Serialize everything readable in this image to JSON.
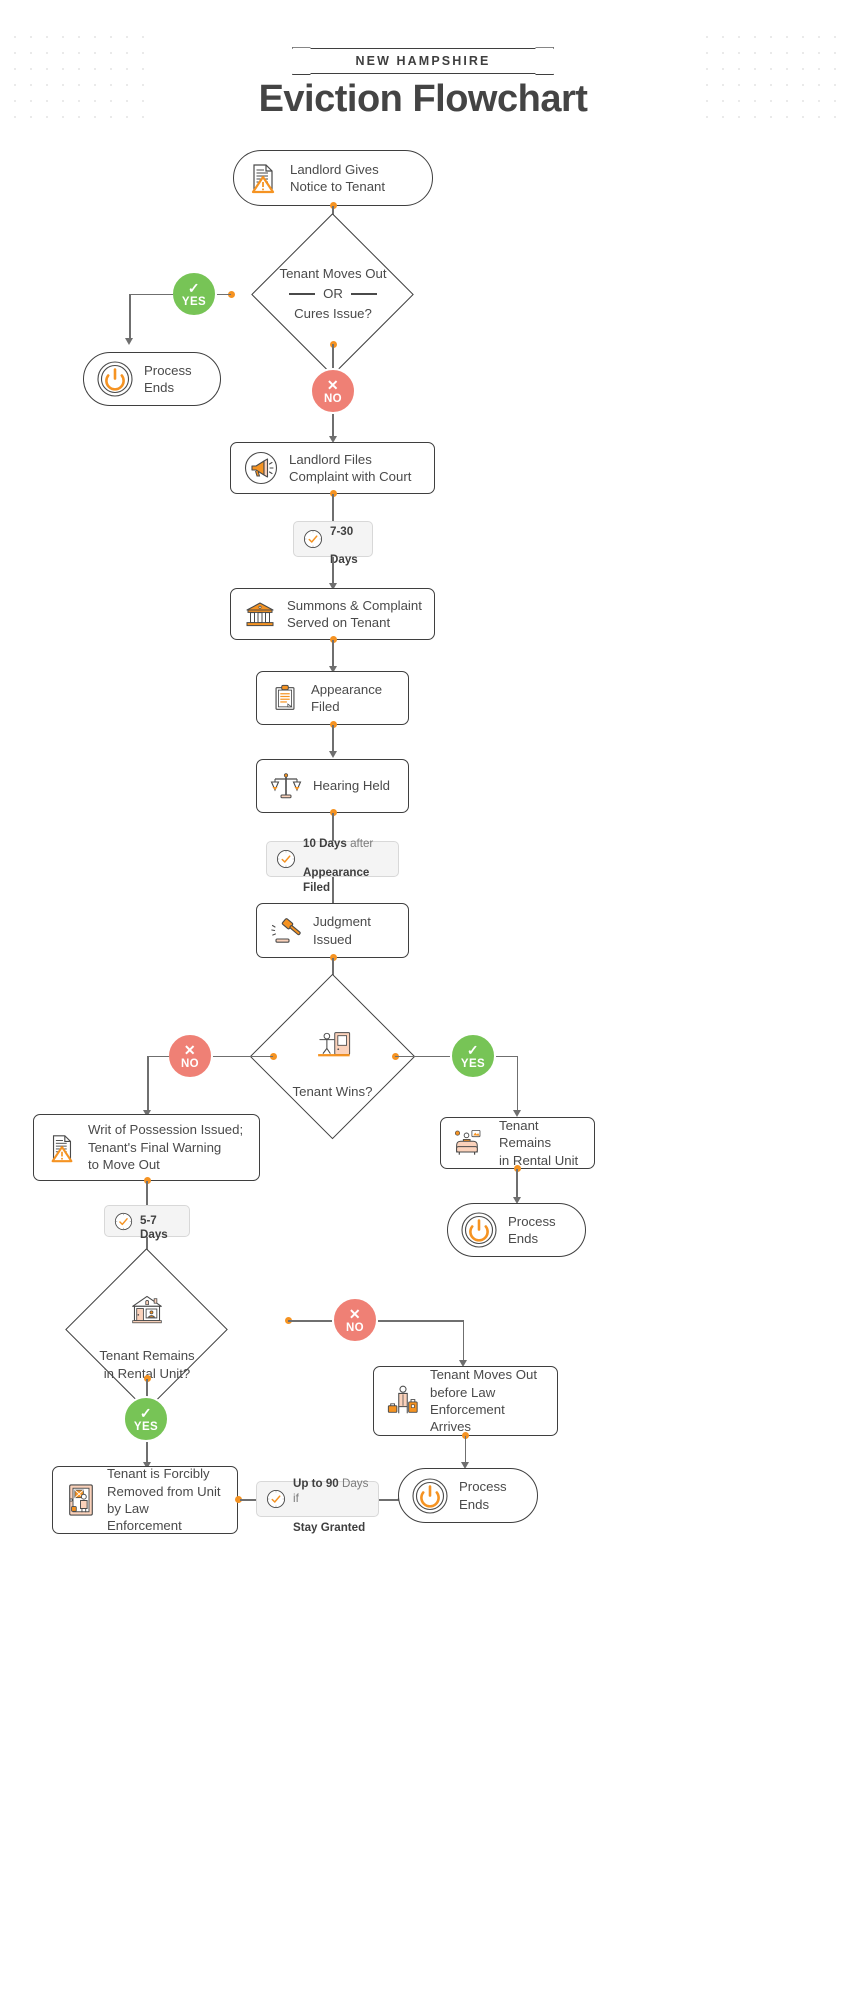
{
  "header": {
    "ribbon_label": "NEW HAMPSHIRE",
    "title": "Eviction Flowchart"
  },
  "colors": {
    "yes_green": "#77c456",
    "no_red": "#ef8075",
    "accent_orange": "#f59322",
    "text_dark": "#4a4a4a",
    "line_gray": "#6f6f6f",
    "timebox_bg": "#f4f4f4"
  },
  "badges": {
    "yes_label": "YES",
    "no_label": "NO"
  },
  "nodes": {
    "notice": {
      "label": "Landlord Gives\nNotice to Tenant",
      "icon": "notice-document-icon"
    },
    "process_ends_1": {
      "label": "Process\nEnds",
      "icon": "power-icon"
    },
    "complaint": {
      "label": "Landlord Files\nComplaint with Court",
      "icon": "megaphone-icon"
    },
    "summons": {
      "label": "Summons & Complaint\nServed on Tenant",
      "icon": "courthouse-icon"
    },
    "appearance": {
      "label": "Appearance\nFiled",
      "icon": "clipboard-icon"
    },
    "hearing": {
      "label": "Hearing Held",
      "icon": "scales-icon"
    },
    "judgment": {
      "label": "Judgment\nIssued",
      "icon": "gavel-icon"
    },
    "writ": {
      "label": "Writ of Possession Issued;\nTenant's Final Warning\nto Move Out",
      "icon": "notice-document-icon"
    },
    "remains": {
      "label": "Tenant Remains\nin Rental Unit",
      "icon": "sofa-icon"
    },
    "process_ends_2": {
      "label": "Process\nEnds",
      "icon": "power-icon"
    },
    "moves_out": {
      "label": "Tenant Moves Out\nbefore Law\nEnforcement Arrives",
      "icon": "luggage-person-icon"
    },
    "forcibly_removed": {
      "label": "Tenant is Forcibly\nRemoved from Unit\nby Law Enforcement",
      "icon": "eviction-door-icon"
    },
    "process_ends_3": {
      "label": "Process\nEnds",
      "icon": "power-icon"
    }
  },
  "decisions": {
    "moves_or_cures": {
      "line1": "Tenant Moves Out",
      "line2": "OR",
      "line3": "Cures Issue?"
    },
    "tenant_wins": {
      "label": "Tenant Wins?",
      "icon": "tenant-door-icon"
    },
    "remains_unit": {
      "label": "Tenant Remains\nin Rental Unit?",
      "icon": "house-icon"
    }
  },
  "timeboxes": {
    "t7_30": {
      "bold": "7-30",
      "light": "",
      "second": "Days",
      "icon": "clock-icon"
    },
    "t10": {
      "bold": "10 Days",
      "light": " after",
      "second": "Appearance Filed",
      "icon": "clock-icon"
    },
    "t5_7": {
      "bold": "5-7 Days",
      "light": "",
      "second": "",
      "icon": "clock-icon"
    },
    "t90": {
      "bold": "Up to 90",
      "light": " Days if",
      "second": "Stay Granted",
      "icon": "clock-icon"
    }
  }
}
